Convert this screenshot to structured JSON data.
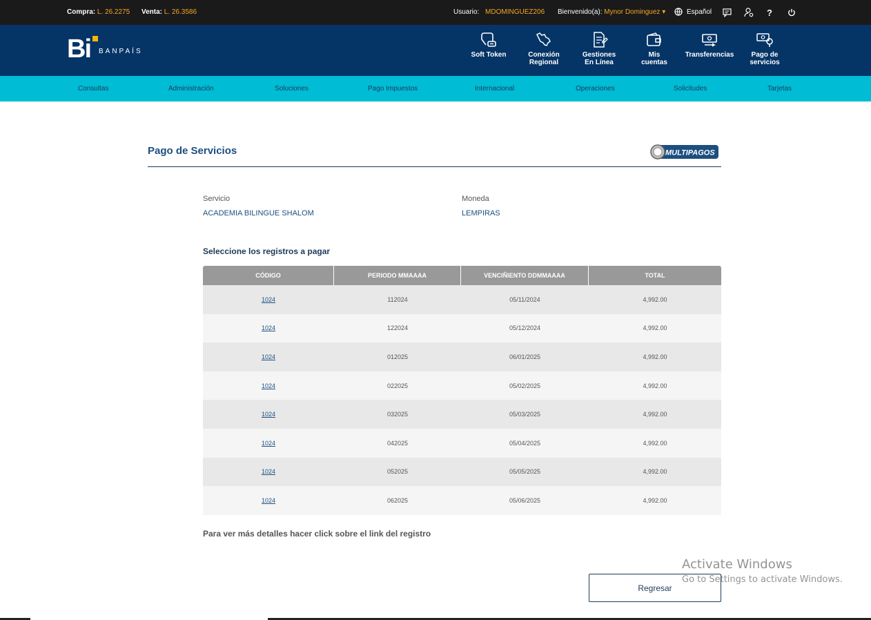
{
  "topbar": {
    "compra_label": "Compra:",
    "compra_value": "L. 26.2275",
    "venta_label": "Venta:",
    "venta_value": "L. 26.3586",
    "usuario_label": "Usuario:",
    "usuario_value": "MDOMINGUEZ206",
    "bienvenido_label": "Bienvenido(a):",
    "bienvenido_value": "Mynor Dominguez",
    "language": "Español",
    "help_label": "?"
  },
  "brand": {
    "logo_text": "Bi",
    "name": "BANPAÍS"
  },
  "header_nav": [
    {
      "line1": "",
      "line2": "Soft Token",
      "icon": "soft-token-icon"
    },
    {
      "line1": "Conexión",
      "line2": "Regional",
      "icon": "regional-map-icon"
    },
    {
      "line1": "Gestiones",
      "line2": "En Línea",
      "icon": "document-edit-icon"
    },
    {
      "line1": "Mis",
      "line2": "cuentas",
      "icon": "wallet-icon"
    },
    {
      "line1": "",
      "line2": "Transferencias",
      "icon": "money-transfer-icon"
    },
    {
      "line1": "Pago de",
      "line2": "servicios",
      "icon": "service-payment-icon"
    }
  ],
  "menu": [
    "Consultas",
    "Administración",
    "Soluciones",
    "Pago Impuestos",
    "Internacional",
    "Operaciones",
    "Solicitudes",
    "Tarjetas"
  ],
  "page": {
    "title": "Pago de Servicios",
    "partner_logo": "MULTIPAGOS",
    "servicio_label": "Servicio",
    "servicio_value": "ACADEMIA BILINGUE SHALOM",
    "moneda_label": "Moneda",
    "moneda_value": "LEMPIRAS",
    "subtitle": "Seleccione los registros a pagar",
    "hint": "Para ver más detalles hacer click sobre el link del registro",
    "back_button": "Regresar"
  },
  "table": {
    "headers": [
      "CÓDIGO",
      "PERIODO MMAAAA",
      "VENCIÑIENTO DDMMAAAA",
      "TOTAL"
    ],
    "rows": [
      [
        "1024",
        "112024",
        "05/11/2024",
        "4,992.00"
      ],
      [
        "1024",
        "122024",
        "05/12/2024",
        "4,992.00"
      ],
      [
        "1024",
        "012025",
        "06/01/2025",
        "4,992.00"
      ],
      [
        "1024",
        "022025",
        "05/02/2025",
        "4,992.00"
      ],
      [
        "1024",
        "032025",
        "05/03/2025",
        "4,992.00"
      ],
      [
        "1024",
        "042025",
        "05/04/2025",
        "4,992.00"
      ],
      [
        "1024",
        "052025",
        "05/05/2025",
        "4,992.00"
      ],
      [
        "1024",
        "062025",
        "05/06/2025",
        "4,992.00"
      ]
    ]
  },
  "watermark": {
    "line1": "Activate Windows",
    "line2": "Go to Settings to activate Windows."
  },
  "colors": {
    "topbar": "#1a1a1a",
    "header": "#053567",
    "menubar": "#00bcd4",
    "accent": "#f5a623",
    "link": "#1c4f80"
  }
}
